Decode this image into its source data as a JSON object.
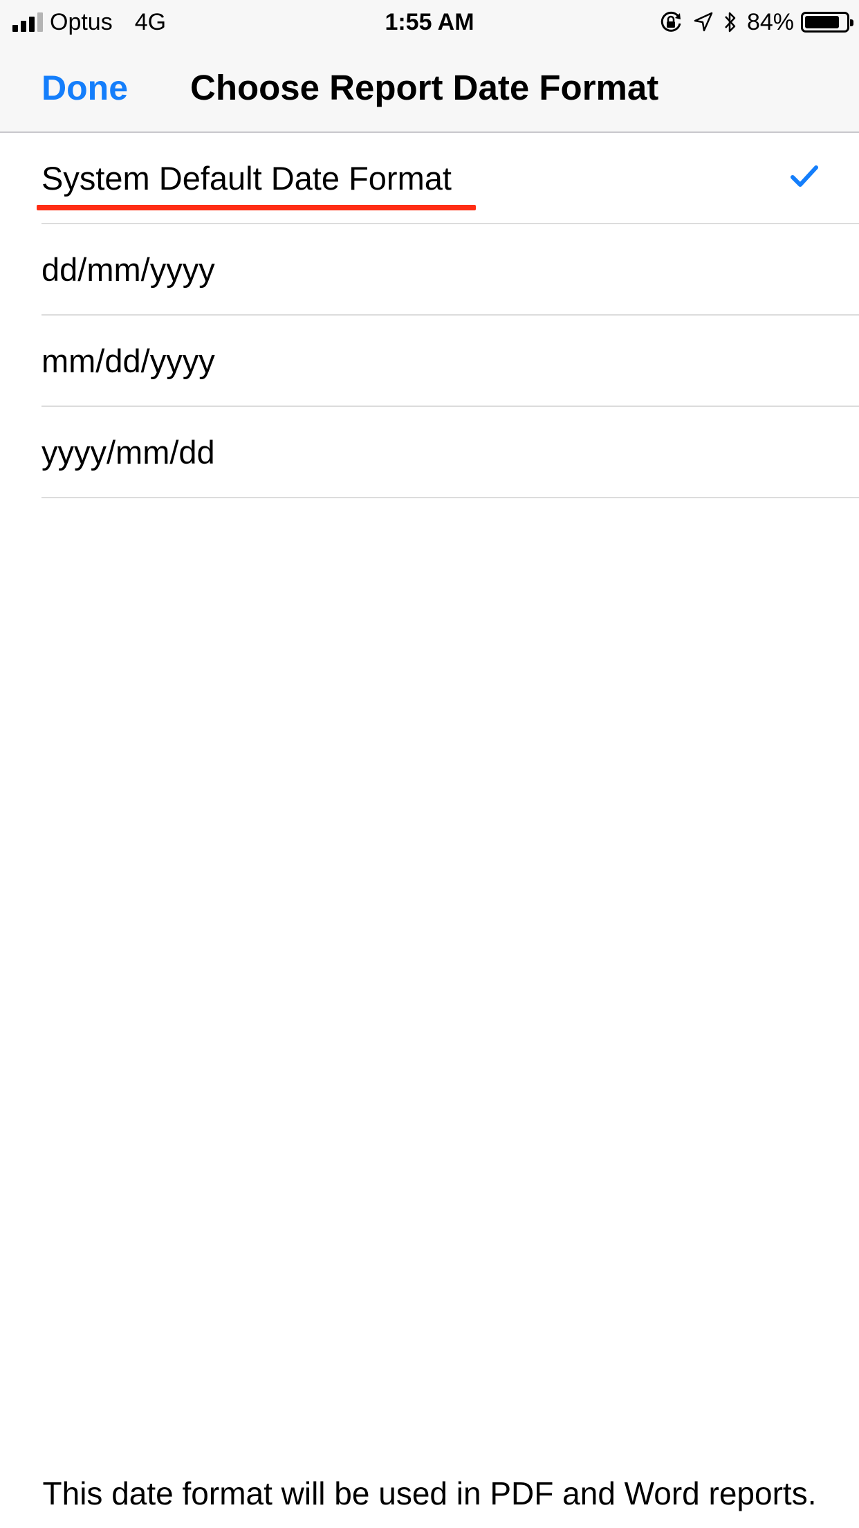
{
  "status_bar": {
    "carrier": "Optus",
    "network": "4G",
    "time": "1:55 AM",
    "battery_percent": "84%",
    "battery_level": 0.84,
    "signal_bars_active": 3,
    "signal_bars_total": 4,
    "icons": [
      "signal-icon",
      "orientation-lock-icon",
      "location-arrow-icon",
      "bluetooth-icon",
      "battery-icon"
    ]
  },
  "nav": {
    "done_label": "Done",
    "title": "Choose Report Date Format"
  },
  "options": [
    {
      "label": "System Default Date Format",
      "selected": true
    },
    {
      "label": "dd/mm/yyyy",
      "selected": false
    },
    {
      "label": "mm/dd/yyyy",
      "selected": false
    },
    {
      "label": "yyyy/mm/dd",
      "selected": false
    }
  ],
  "footer": {
    "note": "This date format will be used in PDF and Word reports."
  },
  "colors": {
    "accent": "#147efb",
    "highlight_underline": "#ff2d14",
    "separator": "#dcdcdc",
    "bar_background": "#f7f7f7"
  }
}
